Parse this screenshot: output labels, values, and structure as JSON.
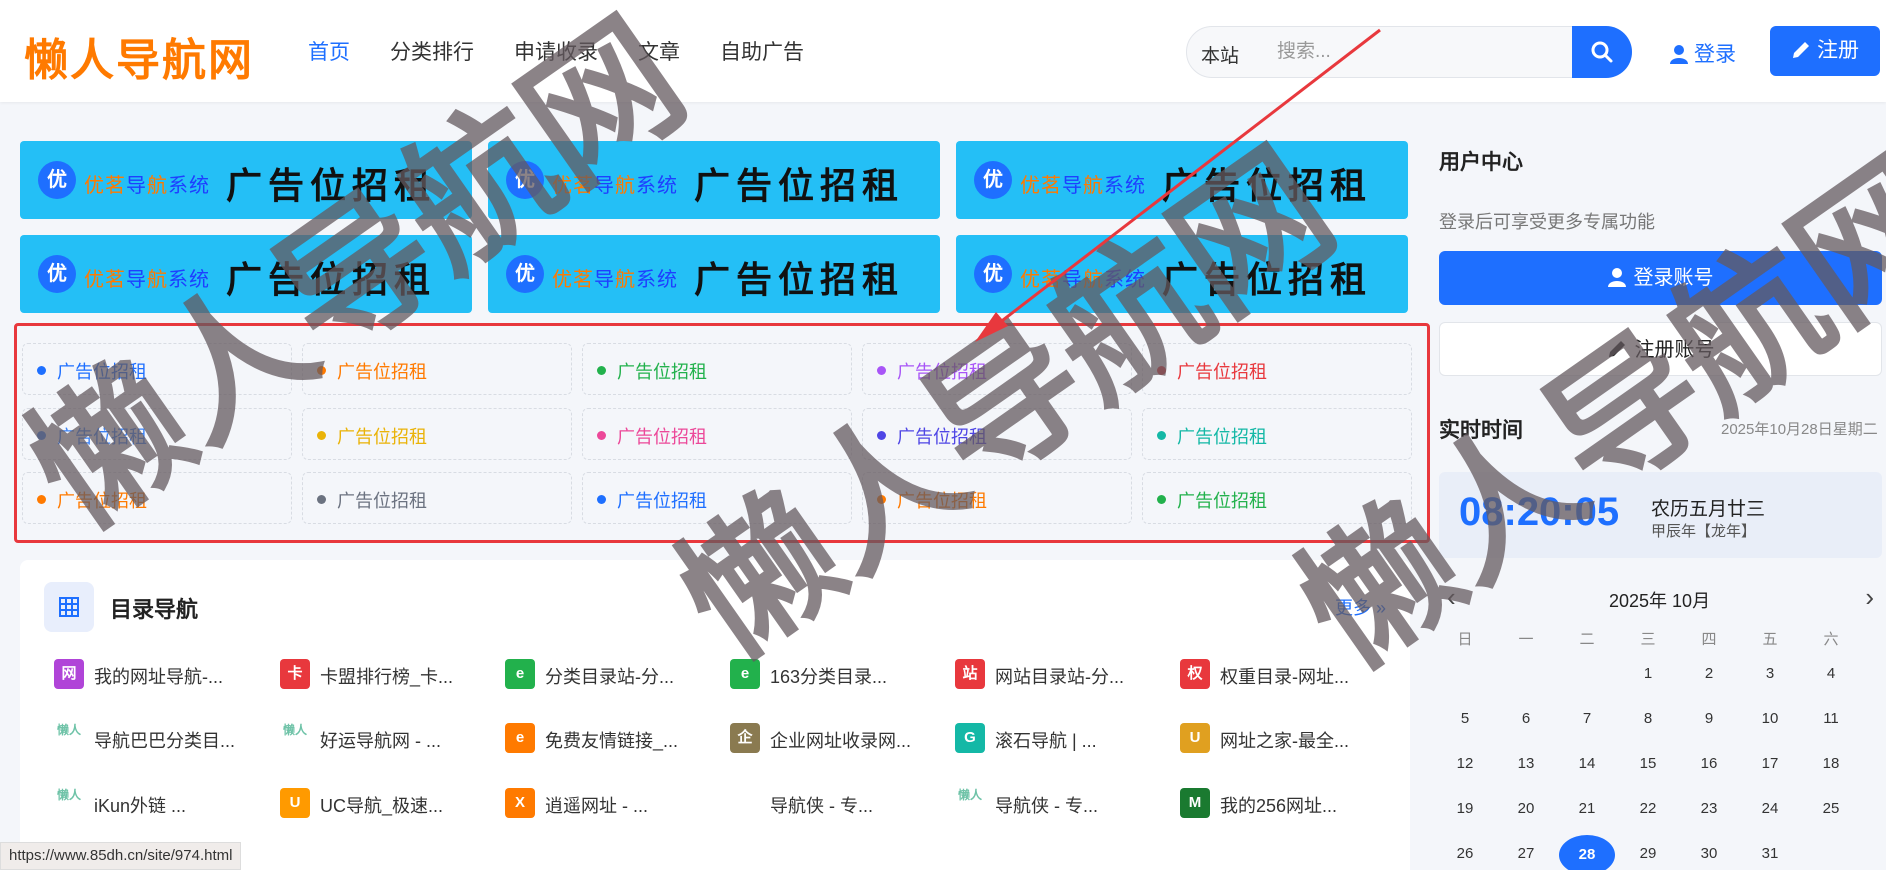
{
  "header": {
    "logo": "懒人导航网",
    "nav": [
      "首页",
      "分类排行",
      "申请收录",
      "文章",
      "自助广告"
    ],
    "search_scope": "本站",
    "search_placeholder": "搜索...",
    "login": "登录",
    "register": "注册"
  },
  "banners": {
    "badge": "优",
    "brand_a": "优茗",
    "brand_b": "导",
    "brand_c": "航",
    "brand_d": "系统",
    "big": "广告位招租"
  },
  "ad_links": [
    {
      "text": "广告位招租",
      "color": "#1e6fff"
    },
    {
      "text": "广告位招租",
      "color": "#ff7a00"
    },
    {
      "text": "广告位招租",
      "color": "#22b14c"
    },
    {
      "text": "广告位招租",
      "color": "#a855f7"
    },
    {
      "text": "广告位招租",
      "color": "#e8383d"
    },
    {
      "text": "广告位招租",
      "color": "#3b82f6"
    },
    {
      "text": "广告位招租",
      "color": "#eab308"
    },
    {
      "text": "广告位招租",
      "color": "#ec4899"
    },
    {
      "text": "广告位招租",
      "color": "#4f46e5"
    },
    {
      "text": "广告位招租",
      "color": "#14b8a6"
    },
    {
      "text": "广告位招租",
      "color": "#ff7a00"
    },
    {
      "text": "广告位招租",
      "color": "#6b7280"
    },
    {
      "text": "广告位招租",
      "color": "#1e6fff"
    },
    {
      "text": "广告位招租",
      "color": "#ff7a00"
    },
    {
      "text": "广告位招租",
      "color": "#22b14c"
    }
  ],
  "directory": {
    "title": "目录导航",
    "more": "更多",
    "items": [
      {
        "text": "我的网址导航-...",
        "icon": "网",
        "color": "#b044d8"
      },
      {
        "text": "卡盟排行榜_卡...",
        "icon": "卡",
        "color": "#e8383d"
      },
      {
        "text": "分类目录站-分...",
        "icon": "e",
        "color": "#22b14c"
      },
      {
        "text": "163分类目录...",
        "icon": "e",
        "color": "#22b14c"
      },
      {
        "text": "网站目录站-分...",
        "icon": "站",
        "color": "#e8383d"
      },
      {
        "text": "权重目录-网址...",
        "icon": "权",
        "color": "#e8383d"
      },
      {
        "text": "导航巴巴分类目...",
        "icon": "懒人",
        "color": "#6fc3a8"
      },
      {
        "text": "好运导航网 - ...",
        "icon": "懒人",
        "color": "#6fc3a8"
      },
      {
        "text": "免费友情链接_...",
        "icon": "e",
        "color": "#ff7a00"
      },
      {
        "text": "企业网址收录网...",
        "icon": "企",
        "color": "#8a7a50"
      },
      {
        "text": "滚石导航 | ...",
        "icon": "G",
        "color": "#14b8a6"
      },
      {
        "text": "网址之家-最全...",
        "icon": "U",
        "color": "#e0a020"
      },
      {
        "text": "iKun外链 ...",
        "icon": "懒人",
        "color": "#6fc3a8"
      },
      {
        "text": "UC导航_极速...",
        "icon": "U",
        "color": "#ff9a00"
      },
      {
        "text": "逍遥网址 - ...",
        "icon": "X",
        "color": "#ff7a00"
      },
      {
        "text": "导航侠 - 专...",
        "icon": "",
        "color": "#ffffff"
      },
      {
        "text": "导航侠 - 专...",
        "icon": "懒人",
        "color": "#6fc3a8"
      },
      {
        "text": "我的256网址...",
        "icon": "M",
        "color": "#1a7a30"
      }
    ]
  },
  "user_center": {
    "title": "用户中心",
    "desc": "登录后可享受更多专属功能",
    "login_btn": "登录账号",
    "register_btn": "注册账号"
  },
  "realtime": {
    "title": "实时时间",
    "date": "2025年10月28日星期二",
    "clock": "08:20:05",
    "lunar": "农历五月廿三",
    "ganzhi": "甲辰年【龙年】"
  },
  "calendar": {
    "month": "2025年 10月",
    "prev": "‹",
    "next": "›",
    "weekdays": [
      "日",
      "一",
      "二",
      "三",
      "四",
      "五",
      "六"
    ],
    "days": [
      "",
      "",
      "",
      "1",
      "2",
      "3",
      "4",
      "5",
      "6",
      "7",
      "8",
      "9",
      "10",
      "11",
      "12",
      "13",
      "14",
      "15",
      "16",
      "17",
      "18",
      "19",
      "20",
      "21",
      "22",
      "23",
      "24",
      "25",
      "26",
      "27",
      "28",
      "29",
      "30",
      "31"
    ],
    "today": "28"
  },
  "status_url": "https://www.85dh.cn/site/974.html",
  "watermark": [
    "懒人导航网",
    "懒人导航网",
    "懒人导航网"
  ],
  "colors": {
    "primary": "#1e6fff",
    "banner": "#24bff6",
    "highlight": "#e8383d",
    "logo": "#ff7a00"
  }
}
